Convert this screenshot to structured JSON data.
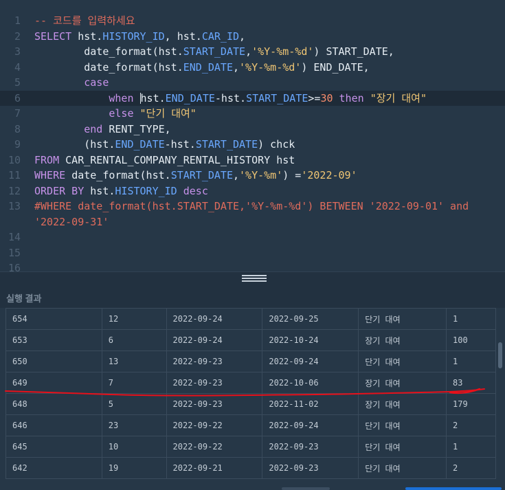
{
  "editor": {
    "lines": [
      {
        "n": "1",
        "segments": [
          {
            "t": "-- 코드를 입력하세요",
            "c": "cmt"
          }
        ]
      },
      {
        "n": "2",
        "segments": [
          {
            "t": "SELECT ",
            "c": "kw"
          },
          {
            "t": "hst.",
            "c": ""
          },
          {
            "t": "HISTORY_ID",
            "c": "prop"
          },
          {
            "t": ", hst.",
            "c": ""
          },
          {
            "t": "CAR_ID",
            "c": "prop"
          },
          {
            "t": ",",
            "c": ""
          }
        ]
      },
      {
        "n": "3",
        "segments": [
          {
            "t": "        date_format(hst.",
            "c": ""
          },
          {
            "t": "START_DATE",
            "c": "prop"
          },
          {
            "t": ",",
            "c": ""
          },
          {
            "t": "'%Y-%m-%d'",
            "c": "str"
          },
          {
            "t": ") START_DATE,",
            "c": ""
          }
        ]
      },
      {
        "n": "4",
        "segments": [
          {
            "t": "        date_format(hst.",
            "c": ""
          },
          {
            "t": "END_DATE",
            "c": "prop"
          },
          {
            "t": ",",
            "c": ""
          },
          {
            "t": "'%Y-%m-%d'",
            "c": "str"
          },
          {
            "t": ") END_DATE,",
            "c": ""
          }
        ]
      },
      {
        "n": "5",
        "segments": [
          {
            "t": "        ",
            "c": ""
          },
          {
            "t": "case",
            "c": "kw"
          }
        ]
      },
      {
        "n": "6",
        "active": true,
        "segments": [
          {
            "t": "            ",
            "c": ""
          },
          {
            "t": "when ",
            "c": "kw"
          },
          {
            "t": "CURSOR",
            "c": "cursor"
          },
          {
            "t": "hst.",
            "c": ""
          },
          {
            "t": "END_DATE",
            "c": "prop"
          },
          {
            "t": "-hst.",
            "c": ""
          },
          {
            "t": "START_DATE",
            "c": "prop"
          },
          {
            "t": ">=",
            "c": ""
          },
          {
            "t": "30",
            "c": "num"
          },
          {
            "t": " then ",
            "c": "kw"
          },
          {
            "t": "\"장기 대여\"",
            "c": "str"
          }
        ]
      },
      {
        "n": "7",
        "segments": [
          {
            "t": "            ",
            "c": ""
          },
          {
            "t": "else ",
            "c": "kw"
          },
          {
            "t": "\"단기 대여\"",
            "c": "str"
          }
        ]
      },
      {
        "n": "8",
        "segments": [
          {
            "t": "        ",
            "c": ""
          },
          {
            "t": "end ",
            "c": "kw"
          },
          {
            "t": "RENT_TYPE,",
            "c": ""
          }
        ]
      },
      {
        "n": "9",
        "segments": [
          {
            "t": "        (hst.",
            "c": ""
          },
          {
            "t": "END_DATE",
            "c": "prop"
          },
          {
            "t": "-hst.",
            "c": ""
          },
          {
            "t": "START_DATE",
            "c": "prop"
          },
          {
            "t": ") chck",
            "c": ""
          }
        ]
      },
      {
        "n": "10",
        "segments": [
          {
            "t": "FROM ",
            "c": "kw"
          },
          {
            "t": "CAR_RENTAL_COMPANY_RENTAL_HISTORY hst",
            "c": ""
          }
        ]
      },
      {
        "n": "11",
        "segments": [
          {
            "t": "WHERE ",
            "c": "kw"
          },
          {
            "t": "date_format(hst.",
            "c": ""
          },
          {
            "t": "START_DATE",
            "c": "prop"
          },
          {
            "t": ",",
            "c": ""
          },
          {
            "t": "'%Y-%m'",
            "c": "str"
          },
          {
            "t": ") =",
            "c": ""
          },
          {
            "t": "'2022-09'",
            "c": "str"
          }
        ]
      },
      {
        "n": "12",
        "segments": [
          {
            "t": "ORDER BY ",
            "c": "kw"
          },
          {
            "t": "hst.",
            "c": ""
          },
          {
            "t": "HISTORY_ID",
            "c": "prop"
          },
          {
            "t": " desc",
            "c": "kw"
          }
        ]
      },
      {
        "n": "13",
        "segments": [
          {
            "t": "#WHERE date_format(hst.START_DATE,'%Y-%m-%d') BETWEEN '2022-09-01' and",
            "c": "cmt"
          }
        ]
      },
      {
        "n": "",
        "segments": [
          {
            "t": "'2022-09-31'",
            "c": "cmt"
          }
        ]
      },
      {
        "n": "14",
        "segments": []
      },
      {
        "n": "15",
        "segments": []
      },
      {
        "n": "16",
        "segments": []
      }
    ]
  },
  "results": {
    "title": "실행 결과",
    "rows": [
      [
        "654",
        "12",
        "2022-09-24",
        "2022-09-25",
        "단기 대여",
        "1"
      ],
      [
        "653",
        "6",
        "2022-09-24",
        "2022-10-24",
        "장기 대여",
        "100"
      ],
      [
        "650",
        "13",
        "2022-09-23",
        "2022-09-24",
        "단기 대여",
        "1"
      ],
      [
        "649",
        "7",
        "2022-09-23",
        "2022-10-06",
        "장기 대여",
        "83"
      ],
      [
        "648",
        "5",
        "2022-09-23",
        "2022-11-02",
        "장기 대여",
        "179"
      ],
      [
        "646",
        "23",
        "2022-09-22",
        "2022-09-24",
        "단기 대여",
        "2"
      ],
      [
        "645",
        "10",
        "2022-09-22",
        "2022-09-23",
        "단기 대여",
        "1"
      ],
      [
        "642",
        "19",
        "2022-09-21",
        "2022-09-23",
        "단기 대여",
        "2"
      ]
    ]
  },
  "colors": {
    "background": "#263747",
    "keyword": "#c792ea",
    "property": "#6aa8ff",
    "string": "#f0c674",
    "comment": "#e06c5c",
    "annotation": "#e8101a"
  }
}
